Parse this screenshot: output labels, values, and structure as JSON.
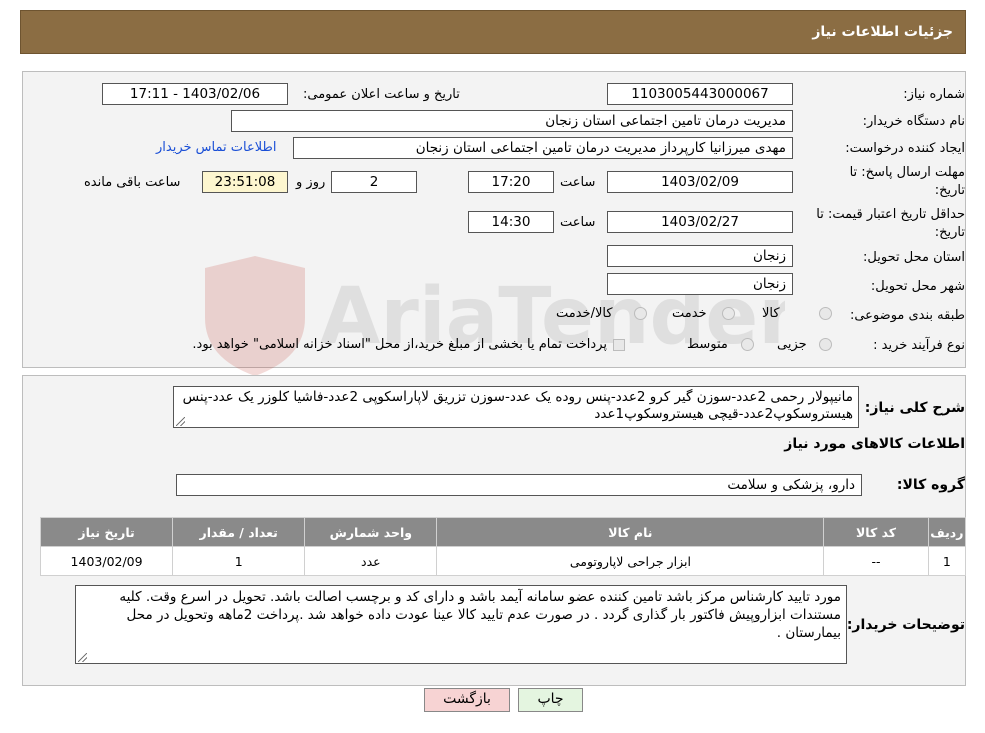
{
  "header": {
    "title": "جزئیات اطلاعات نیاز"
  },
  "form": {
    "need_number_label": "شماره نیاز:",
    "need_number": "1103005443000067",
    "announce_label": "تاریخ و ساعت اعلان عمومی:",
    "announce_value": "1403/02/06 - 17:11",
    "buyer_org_label": "نام دستگاه خریدار:",
    "buyer_org": "مدیریت درمان تامین اجتماعی استان زنجان",
    "creator_label": "ایجاد کننده درخواست:",
    "creator": "مهدی میرزانیا کارپرداز مدیریت درمان تامین اجتماعی استان زنجان",
    "contact_link": "اطلاعات تماس خریدار",
    "deadline_label": "مهلت ارسال پاسخ: تا تاریخ:",
    "deadline_date": "1403/02/09",
    "time_label": "ساعت",
    "deadline_time": "17:20",
    "days_value": "2",
    "days_label": "روز و",
    "remaining_time": "23:51:08",
    "remaining_label": "ساعت باقی مانده",
    "validity_label": "حداقل تاریخ اعتبار قیمت: تا تاریخ:",
    "validity_date": "1403/02/27",
    "validity_time": "14:30",
    "province_label": "استان محل تحویل:",
    "province": "زنجان",
    "city_label": "شهر محل تحویل:",
    "city": "زنجان",
    "category_label": "طبقه بندی موضوعی:",
    "category_options": [
      "کالا",
      "خدمت",
      "کالا/خدمت"
    ],
    "process_label": "نوع فرآیند خرید :",
    "process_options": [
      "جزیی",
      "متوسط"
    ],
    "payment_note": "پرداخت تمام یا بخشی از مبلغ خرید،از محل \"اسناد خزانه اسلامی\" خواهد بود."
  },
  "details": {
    "summary_label": "شرح کلی نیاز:",
    "summary": "مانیپولار رحمی 2عدد-سوزن گیر کرو 2عدد-پنس روده یک عدد-سوزن تزریق لاپاراسکوپی 2عدد-فاشیا کلوزر یک عدد-پنس هیستروسکوپ2عدد-قیچی هیستروسکوپ1عدد",
    "goods_info_title": "اطلاعات کالاهای مورد نیاز",
    "goods_group_label": "گروه کالا:",
    "goods_group": "دارو، پزشکی و سلامت"
  },
  "table": {
    "headers": [
      "ردیف",
      "کد کالا",
      "نام کالا",
      "واحد شمارش",
      "تعداد / مقدار",
      "تاریخ نیاز"
    ],
    "rows": [
      [
        "1",
        "--",
        "ابزار جراحی لاپاروتومی",
        "عدد",
        "1",
        "1403/02/09"
      ]
    ]
  },
  "buyer_notes": {
    "label": "توضیحات خریدار:",
    "text": "مورد تایید کارشناس مرکز باشد تامین کننده عضو سامانه آیمد باشد و دارای کد  و برچسب اصالت باشد. تحویل در اسرع وقت. کلیه مستندات ابزاروپیش فاکتور بار گذاری گردد . در صورت عدم تایید کالا عینا عودت داده خواهد شد .پرداخت 2ماهه وتحویل در محل بیمارستان ."
  },
  "buttons": {
    "print": "چاپ",
    "back": "بازگشت"
  },
  "watermark": {
    "text": "AriaTender.neT"
  },
  "colors": {
    "header_bg": "#8b6d43",
    "link": "#1a4fd6",
    "back_btn": "#f7d3d3",
    "print_btn": "#e4f5e0"
  }
}
